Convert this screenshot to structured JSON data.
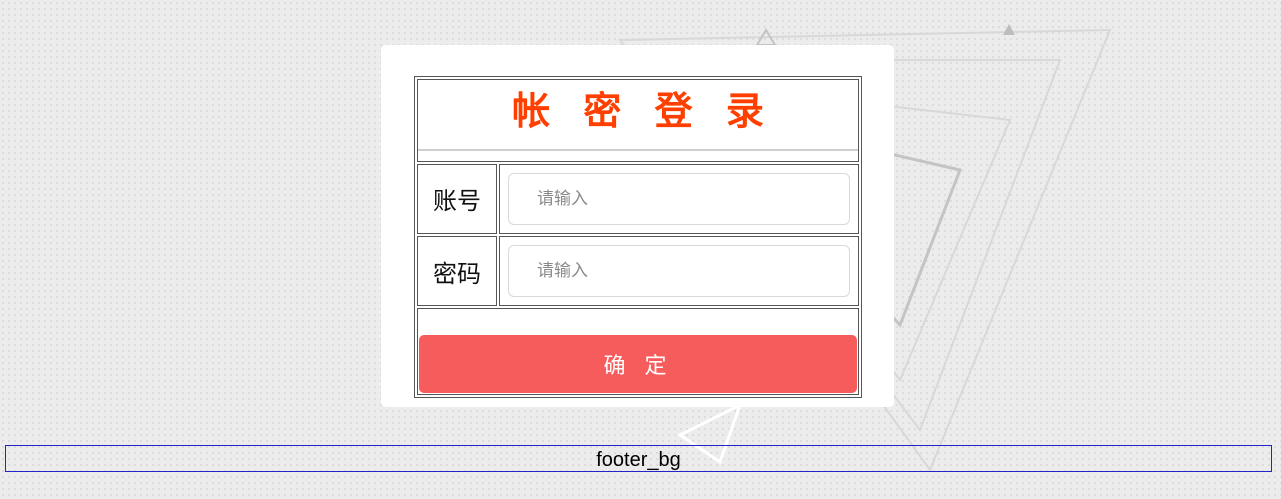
{
  "login": {
    "title": "帐 密 登 录",
    "account_label": "账号",
    "account_placeholder": "请输入",
    "account_value": "",
    "password_label": "密码",
    "password_placeholder": "请输入",
    "password_value": "",
    "confirm_label": "确 定"
  },
  "footer": {
    "label": "footer_bg"
  },
  "colors": {
    "title": "#ff3f00",
    "button": "#f75c5c",
    "footer_border": "#2323c8"
  }
}
